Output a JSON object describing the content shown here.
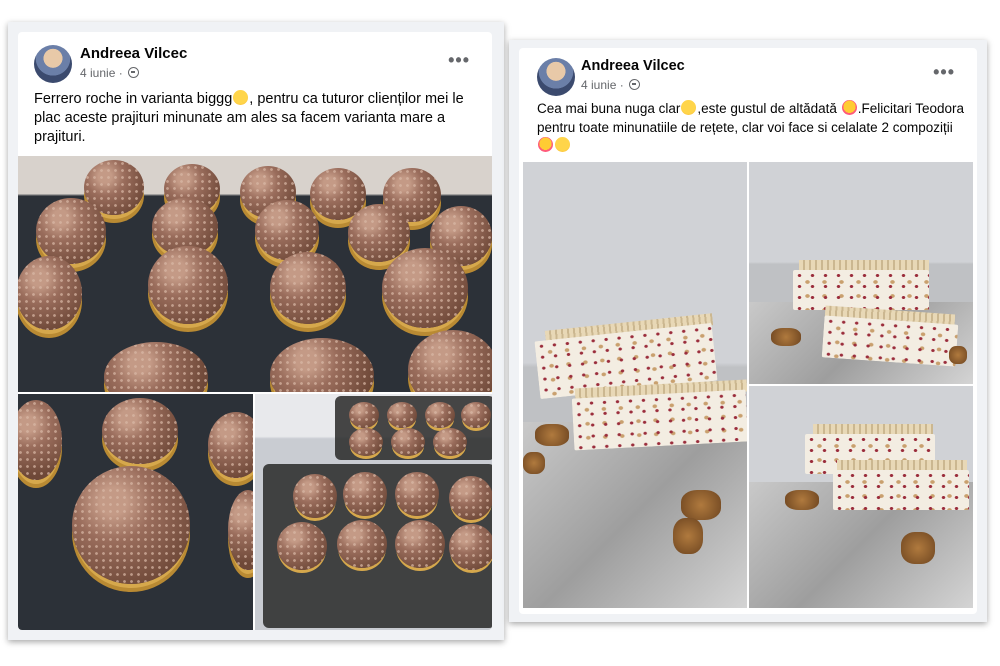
{
  "posts": [
    {
      "author": "Andreea Vilcec",
      "date": "4 iunie",
      "more": "•••",
      "text_parts": [
        "Ferrero roche in varianta biggg",
        ", pentru ca tuturor clienților mei le plac aceste prajituri minunate am ales sa facem varianta mare a prajituri."
      ]
    },
    {
      "author": "Andreea Vilcec",
      "date": "4 iunie",
      "more": "•••",
      "text_parts": [
        "Cea mai buna nuga clar",
        ",este gustul de altădată ",
        ".Felicitari Teodora pentru toate minunatiile de rețete, clar voi face si celalate 2 compoziții "
      ]
    }
  ],
  "icons": {
    "globe": "globe-icon",
    "more": "more-options-icon",
    "emoji": "emoji-icon"
  }
}
